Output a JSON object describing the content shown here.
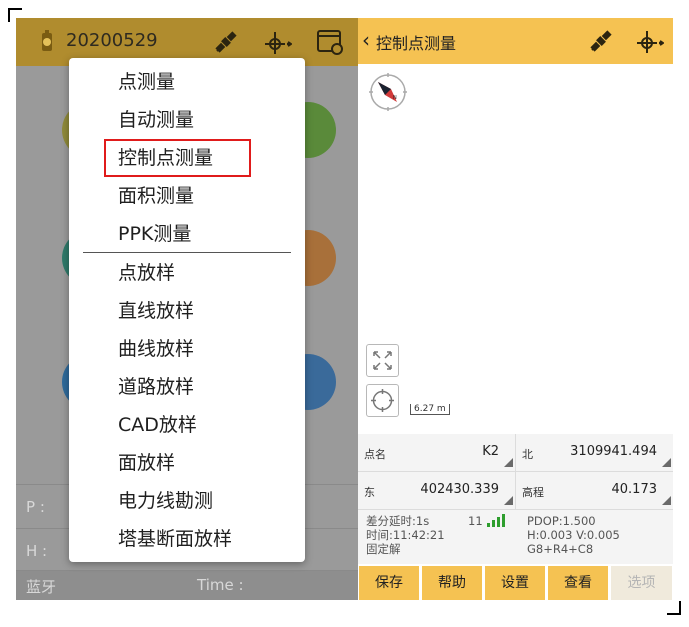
{
  "left": {
    "project_name": "20200529",
    "menu_items": [
      "点测量",
      "自动测量",
      "控制点测量",
      "面积测量",
      "PPK测量",
      "点放样",
      "直线放样",
      "曲线放样",
      "道路放样",
      "CAD放样",
      "面放样",
      "电力线勘测",
      "塔基断面放样"
    ],
    "highlighted_item": "控制点测量",
    "row_p_label": "P :",
    "row_h_label": "H :",
    "bottom_left": "蓝牙",
    "bottom_right": "Time :",
    "colors": {
      "topbar": "#b08c2e",
      "dim_background": "#9a9a9a",
      "highlight_border": "#e01b1b"
    }
  },
  "right": {
    "title": "控制点测量",
    "scale_label": "6.27 m",
    "fields": {
      "point_name_label": "点名",
      "point_name_value": "K2",
      "north_label": "北",
      "north_value": "3109941.494",
      "east_label": "东",
      "east_value": "402430.339",
      "elev_label": "高程",
      "elev_value": "40.173"
    },
    "status": {
      "diff_delay": "差分延时:1s",
      "sat_count": "11",
      "time": "时间:11:42:21",
      "fix": "固定解",
      "pdop": "PDOP:1.500",
      "hv": "H:0.003  V:0.005",
      "constellations": "G8+R4+C8"
    },
    "buttons": [
      "保存",
      "帮助",
      "设置",
      "查看",
      "选项"
    ],
    "colors": {
      "topbar": "#f5c252",
      "signal": "#2e9e2e",
      "compass_needle": "#d23a3a"
    }
  }
}
